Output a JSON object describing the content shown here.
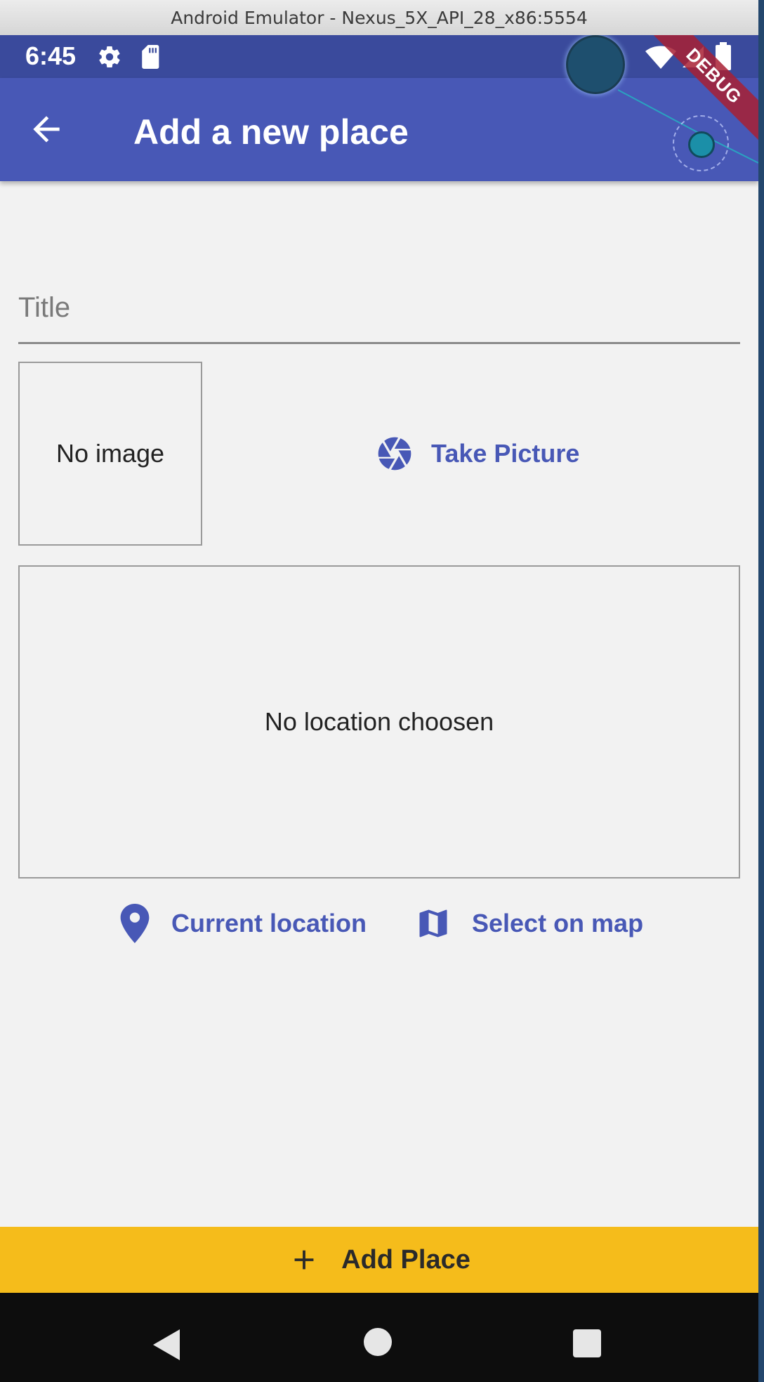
{
  "window": {
    "title": "Android Emulator - Nexus_5X_API_28_x86:5554"
  },
  "status_bar": {
    "time": "6:45"
  },
  "debug_banner": {
    "label": "DEBUG"
  },
  "app_bar": {
    "title": "Add a new place",
    "back_icon": "arrow-back-icon"
  },
  "form": {
    "title_field": {
      "placeholder": "Title",
      "value": ""
    },
    "image_preview": {
      "empty_text": "No image"
    },
    "take_picture": {
      "label": "Take Picture",
      "icon": "camera-icon"
    },
    "location_preview": {
      "empty_text": "No location choosen"
    },
    "current_location": {
      "label": "Current location",
      "icon": "location-pin-icon"
    },
    "select_on_map": {
      "label": "Select on map",
      "icon": "map-icon"
    }
  },
  "submit": {
    "label": "Add Place",
    "icon": "plus-icon"
  },
  "colors": {
    "primary": "#4858b6",
    "status_bar": "#3a4a9c",
    "accent": "#f5bc1b",
    "background": "#f2f2f2"
  }
}
